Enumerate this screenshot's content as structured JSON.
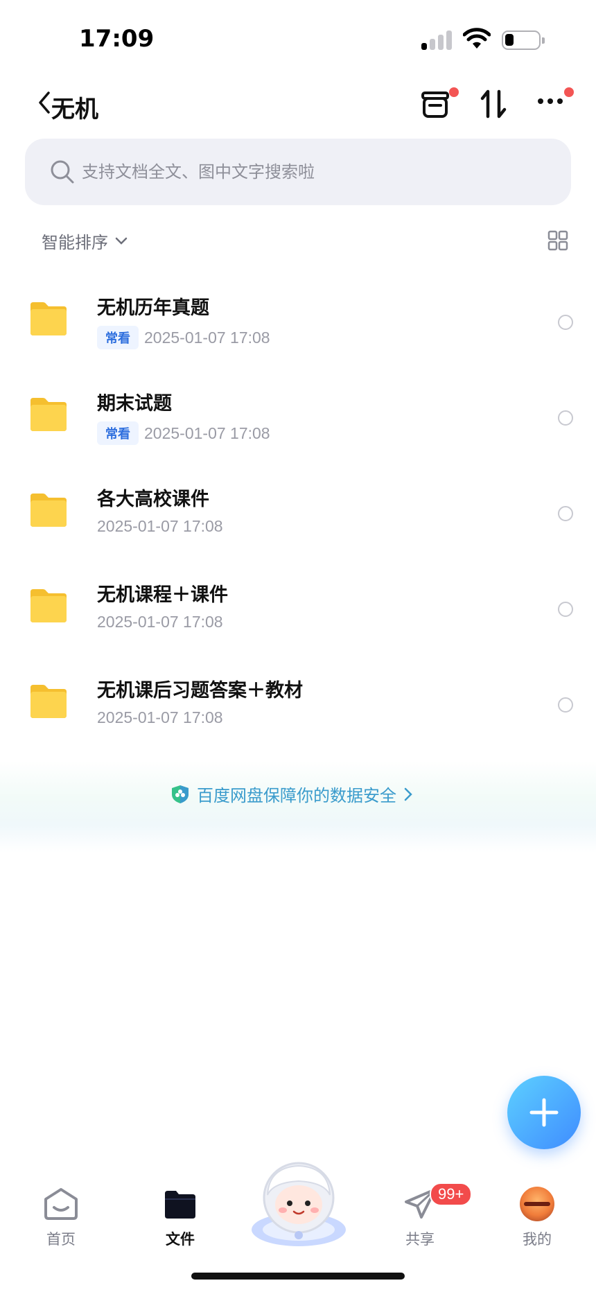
{
  "status_bar": {
    "time": "17:09"
  },
  "header": {
    "title": "无机"
  },
  "search": {
    "placeholder": "支持文档全文、图中文字搜索啦"
  },
  "sort": {
    "label": "智能排序"
  },
  "files": [
    {
      "name": "无机历年真题",
      "tag": "常看",
      "date": "2025-01-07 17:08"
    },
    {
      "name": "期末试题",
      "tag": "常看",
      "date": "2025-01-07 17:08"
    },
    {
      "name": "各大高校课件",
      "tag": "",
      "date": "2025-01-07 17:08"
    },
    {
      "name": "无机课程＋课件",
      "tag": "",
      "date": "2025-01-07 17:08"
    },
    {
      "name": "无机课后习题答案＋教材",
      "tag": "",
      "date": "2025-01-07 17:08"
    }
  ],
  "security_banner": {
    "text": "百度网盘保障你的数据安全"
  },
  "tabbar": {
    "home": "首页",
    "files": "文件",
    "share": "共享",
    "share_badge": "99+",
    "mine": "我的"
  },
  "colors": {
    "accent": "#3f8cff",
    "folder": "#fcd24a",
    "badge": "#f24b4b",
    "secure_text": "#3a9bcc"
  },
  "icons": {
    "back": "chevron-left-icon",
    "recycle": "recycle-bin-icon",
    "transfer": "transfer-icon",
    "more": "more-icon",
    "search": "search-icon",
    "grid": "grid-view-icon",
    "folder": "folder-icon",
    "shield": "shield-icon",
    "plus": "plus-icon"
  }
}
